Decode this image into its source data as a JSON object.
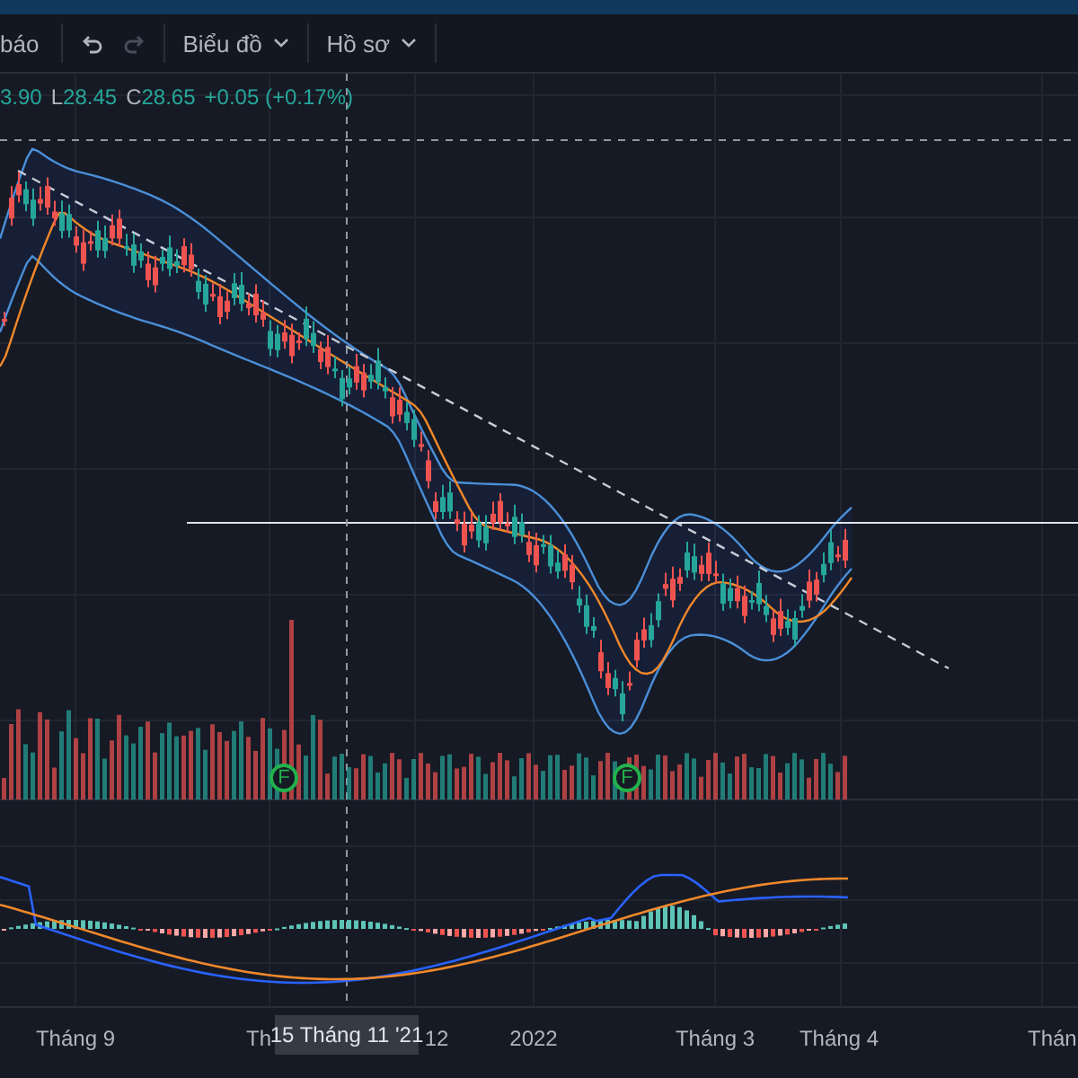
{
  "toolbar": {
    "items": [
      {
        "kind": "text",
        "label": "báo"
      },
      {
        "kind": "undo",
        "disabled": false
      },
      {
        "kind": "redo",
        "disabled": true
      },
      {
        "kind": "menu",
        "label": "Biểu đồ"
      },
      {
        "kind": "menu",
        "label": "Hồ sơ"
      }
    ]
  },
  "legend": [
    {
      "kind": "value",
      "text": "3.90"
    },
    {
      "kind": "key",
      "text": "L"
    },
    {
      "kind": "value",
      "text": "28.45"
    },
    {
      "kind": "key",
      "text": "C"
    },
    {
      "kind": "value",
      "text": "28.65"
    },
    {
      "kind": "value",
      "text": "+0.05 (+0.17%)"
    }
  ],
  "markers": [
    {
      "label": "F"
    },
    {
      "label": "F"
    }
  ],
  "time_axis": {
    "labels": [
      {
        "text": "Tháng 9"
      },
      {
        "text": "Th"
      },
      {
        "text": "12"
      },
      {
        "text": "2022"
      },
      {
        "text": "Tháng 3"
      },
      {
        "text": "Tháng 4"
      },
      {
        "text": "Thán"
      }
    ],
    "crosshair_label": "15 Tháng 11 '21"
  }
}
